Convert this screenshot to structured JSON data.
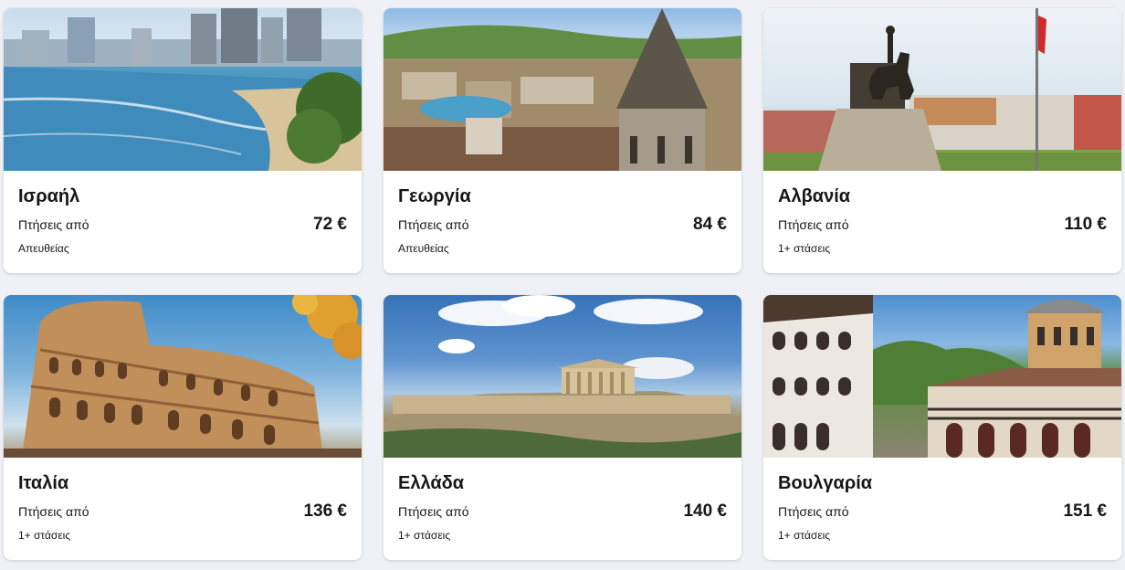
{
  "destinations": [
    {
      "country": "Ισραήλ",
      "flights_from_label": "Πτήσεις από",
      "price": "72 €",
      "stops": "Απευθείας",
      "image_icon": "tel-aviv-coast-photo"
    },
    {
      "country": "Γεωργία",
      "flights_from_label": "Πτήσεις από",
      "price": "84 €",
      "stops": "Απευθείας",
      "image_icon": "tbilisi-city-photo"
    },
    {
      "country": "Αλβανία",
      "flights_from_label": "Πτήσεις από",
      "price": "110 €",
      "stops": "1+ στάσεις",
      "image_icon": "tirana-statue-photo"
    },
    {
      "country": "Ιταλία",
      "flights_from_label": "Πτήσεις από",
      "price": "136 €",
      "stops": "1+ στάσεις",
      "image_icon": "colosseum-photo"
    },
    {
      "country": "Ελλάδα",
      "flights_from_label": "Πτήσεις από",
      "price": "140 €",
      "stops": "1+ στάσεις",
      "image_icon": "acropolis-photo"
    },
    {
      "country": "Βουλγαρία",
      "flights_from_label": "Πτήσεις από",
      "price": "151 €",
      "stops": "1+ στάσεις",
      "image_icon": "rila-monastery-photo"
    }
  ],
  "colors": {
    "page_background": "#eff1f6",
    "card_background": "#ffffff",
    "text": "#161616"
  }
}
